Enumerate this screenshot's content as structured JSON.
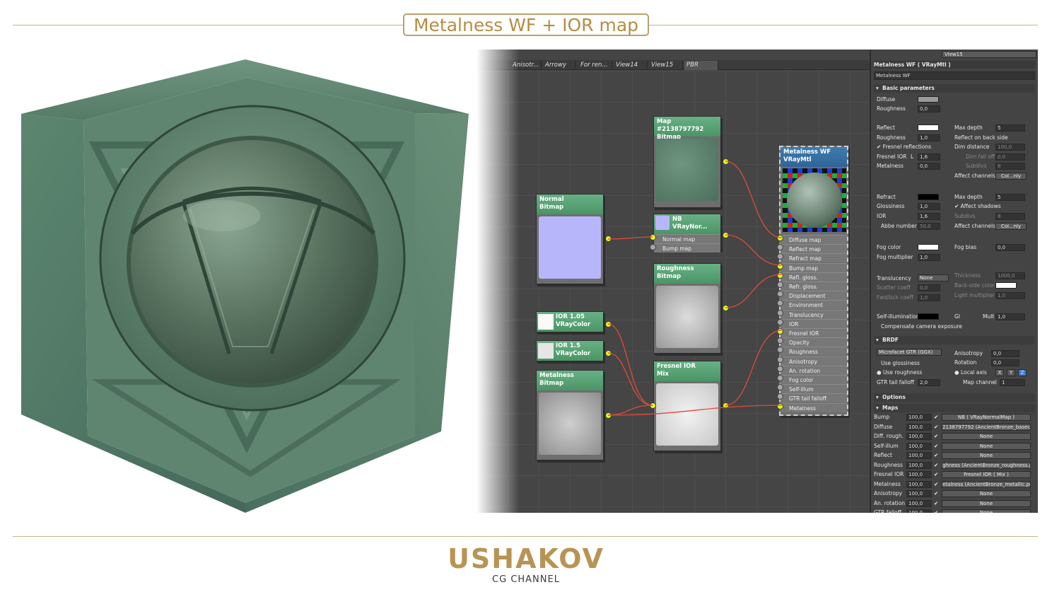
{
  "header": {
    "title": "Metalness WF + IOR map"
  },
  "editor": {
    "view_dropdown": "View15",
    "tabs": [
      "Anisotr...",
      "Arrowy",
      "For ren...",
      "View14",
      "View15",
      "PBR"
    ],
    "active_tab": "PBR",
    "nodes": {
      "map_bitmap": {
        "line1": "Map #2138797792",
        "line2": "Bitmap"
      },
      "normal_bitmap": {
        "line1": "Normal",
        "line2": "Bitmap"
      },
      "nb_normal": {
        "line1": "NB",
        "line2": "VRayNor...",
        "slot1": "Normal map",
        "slot2": "Bump map"
      },
      "roughness_bitmap": {
        "line1": "Roughness",
        "line2": "Bitmap"
      },
      "ior105": {
        "line1": "IOR 1.05",
        "line2": "VRayColor"
      },
      "ior15": {
        "line1": "IOR 1.5",
        "line2": "VRayColor"
      },
      "metalness_bitmap": {
        "line1": "Metalness",
        "line2": "Bitmap"
      },
      "fresnel_mix": {
        "line1": "Fresnel IOR",
        "line2": "Mix"
      },
      "vraymtl": {
        "line1": "Metalness WF",
        "line2": "VRayMtl",
        "slots": [
          "Diffuse map",
          "Reflect map",
          "Refract map",
          "Bump map",
          "Refl. gloss.",
          "Refr. gloss.",
          "Displacement",
          "Environment",
          "Translucency",
          "IOR",
          "Fresnel IOR",
          "Opacity",
          "Roughness",
          "Anisotropy",
          "An. rotation",
          "Fog color",
          "Self-illum",
          "GTR tail falloff",
          "Metalness"
        ]
      }
    }
  },
  "props": {
    "title": "Metalness WF  ( VRayMtl )",
    "name_field": "Metalness WF",
    "basic": {
      "heading": "Basic parameters",
      "diffuse_label": "Diffuse",
      "roughness_label": "Roughness",
      "roughness_value": "0,0",
      "reflect_label": "Reflect",
      "refl_roughness_label": "Roughness",
      "refl_roughness_value": "1,0",
      "fresnel_refl_label": "Fresnel reflections",
      "fresnel_ior_label": "Fresnel IOR",
      "fresnel_ior_lock": "L",
      "fresnel_ior_value": "1,6",
      "metalness_label": "Metalness",
      "metalness_value": "0,0",
      "max_depth_label": "Max depth",
      "max_depth_value": "5",
      "reflect_backside_label": "Reflect on back side",
      "dim_distance_label": "Dim distance",
      "dim_distance_value": "100,0",
      "dim_falloff_label": "Dim fall off",
      "dim_falloff_value": "0,0",
      "subdivs_label": "Subdivs",
      "subdivs_value": "8",
      "affect_channels_label": "Affect channels",
      "affect_channels_value": "Col...nly",
      "refract_label": "Refract",
      "glossiness_label": "Glossiness",
      "glossiness_value": "1,0",
      "ior_label": "IOR",
      "ior_value": "1,6",
      "abbe_label": "Abbe number",
      "abbe_value": "50,0",
      "r_max_depth_label": "Max depth",
      "r_max_depth_value": "5",
      "affect_shadows_label": "Affect shadows",
      "r_subdivs_label": "Subdivs",
      "r_subdivs_value": "8",
      "r_affect_channels_label": "Affect channels",
      "r_affect_channels_value": "Col...nly",
      "fog_color_label": "Fog color",
      "fog_bias_label": "Fog bias",
      "fog_bias_value": "0,0",
      "fog_multiplier_label": "Fog multiplier",
      "fog_multiplier_value": "1,0",
      "translucency_label": "Translucency",
      "translucency_value": "None",
      "thickness_label": "Thickness",
      "thickness_value": "1000,0",
      "scatter_label": "Scatter coeff",
      "scatter_value": "0,0",
      "backside_color_label": "Back-side color",
      "fwd_label": "Fwd/bck coeff",
      "fwd_value": "1,0",
      "light_mult_label": "Light multiplier",
      "light_mult_value": "1,0",
      "self_illum_label": "Self-illumination",
      "gi_label": "GI",
      "mult_label": "Mult",
      "mult_value": "1,0",
      "compensate_label": "Compensate camera exposure"
    },
    "brdf": {
      "heading": "BRDF",
      "type_value": "Microfacet GTR (GGX)",
      "anisotropy_label": "Anisotropy",
      "anisotropy_value": "0,0",
      "rotation_label": "Rotation",
      "rotation_value": "0,0",
      "use_glossiness_label": "Use glossiness",
      "use_roughness_label": "Use roughness",
      "local_axis_label": "Local axis",
      "axis_x": "X",
      "axis_y": "Y",
      "axis_z": "Z",
      "gtr_label": "GTR tail falloff",
      "gtr_value": "2,0",
      "map_channel_label": "Map channel",
      "map_channel_value": "1"
    },
    "options": {
      "heading": "Options"
    },
    "maps": {
      "heading": "Maps",
      "rows": [
        {
          "label": "Bump",
          "amount": "100,0",
          "map": "NB  ( VRayNormalMap )"
        },
        {
          "label": "Diffuse",
          "amount": "100,0",
          "map": "2138797792 (AncientBronze_basecolo"
        },
        {
          "label": "Diff. rough.",
          "amount": "100,0",
          "map": "None"
        },
        {
          "label": "Self-illum",
          "amount": "100,0",
          "map": "None"
        },
        {
          "label": "Reflect",
          "amount": "100,0",
          "map": "None"
        },
        {
          "label": "Roughness",
          "amount": "100,0",
          "map": "ghness (AncientBronze_roughness.p"
        },
        {
          "label": "Fresnel IOR",
          "amount": "100,0",
          "map": "Fresnel IOR  ( Mix )"
        },
        {
          "label": "Metalness",
          "amount": "100,0",
          "map": "etalness (AncientBronze_metallic.png"
        },
        {
          "label": "Anisotropy",
          "amount": "100,0",
          "map": "None"
        },
        {
          "label": "An. rotation",
          "amount": "100,0",
          "map": "None"
        },
        {
          "label": "GTR falloff",
          "amount": "100,0",
          "map": "None"
        }
      ]
    }
  },
  "footer": {
    "logo": "USHAKOV",
    "subtitle": "CG CHANNEL"
  },
  "colors": {
    "accent_gold": "#b48d45",
    "node_header": "#5aa276",
    "wire": "#e04a3a",
    "port": "#e6f51c"
  }
}
